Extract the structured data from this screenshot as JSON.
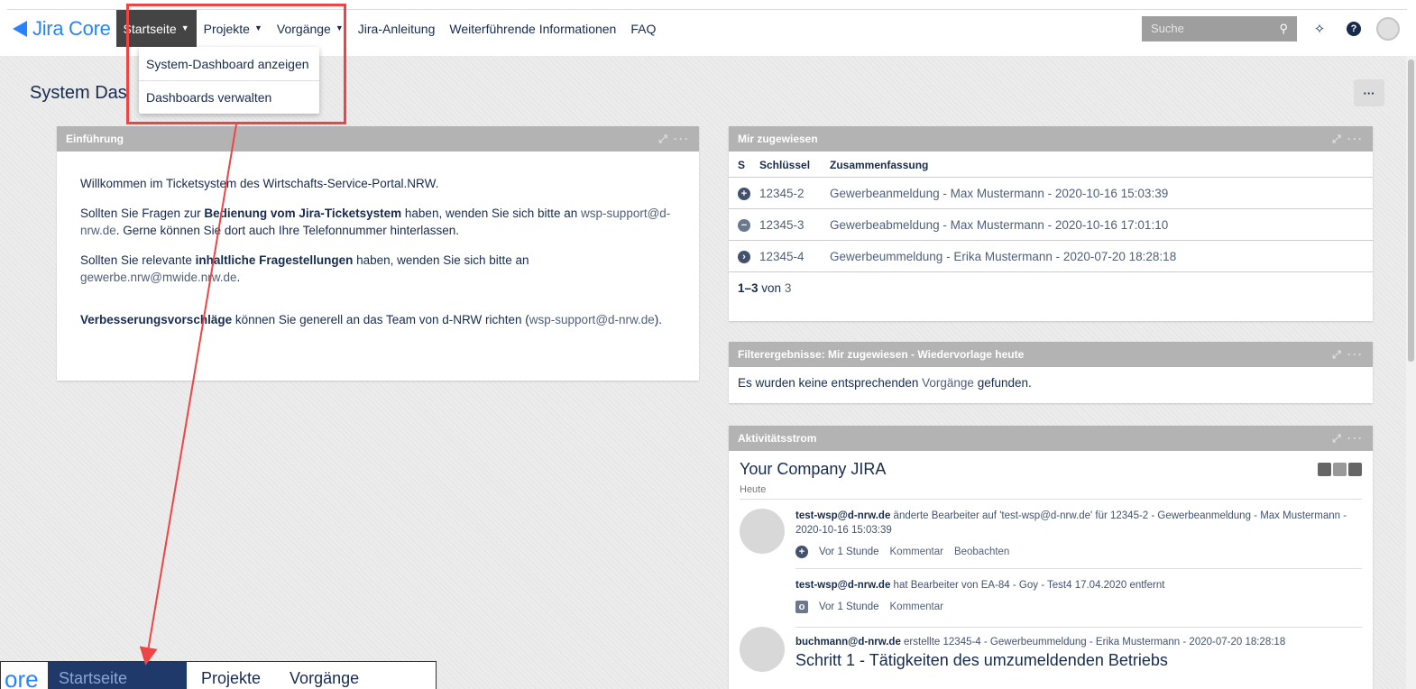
{
  "nav": {
    "logo": "Jira Core",
    "items": [
      {
        "label": "Startseite",
        "dropdown": true,
        "active": true
      },
      {
        "label": "Projekte",
        "dropdown": true
      },
      {
        "label": "Vorgänge",
        "dropdown": true
      },
      {
        "label": "Jira-Anleitung",
        "dropdown": false
      },
      {
        "label": "Weiterführende Informationen",
        "dropdown": false
      },
      {
        "label": "FAQ",
        "dropdown": false
      }
    ],
    "search_placeholder": "Suche"
  },
  "dropdown": {
    "items": [
      "System-Dashboard anzeigen",
      "Dashboards verwalten"
    ]
  },
  "page": {
    "title": "System Das",
    "more": "···"
  },
  "intro": {
    "header": "Einführung",
    "p1": "Willkommen im Ticketsystem des Wirtschafts-Service-Portal.NRW.",
    "p2_a": "Sollten Sie Fragen zur ",
    "p2_b": "Bedienung vom Jira-Ticketsystem",
    "p2_c": " haben, wenden Sie sich bitte an ",
    "p2_link": "wsp-support@d-nrw.de",
    "p2_d": ". Gerne können Sie dort auch Ihre Telefonnummer hinterlassen.",
    "p3_a": "Sollten Sie relevante ",
    "p3_b": "inhaltliche Fragestellungen",
    "p3_c": " haben, wenden Sie sich bitte an ",
    "p3_link": "gewerbe.nrw@mwide.nrw.de",
    "p3_d": ".",
    "p4_a": "Verbesserungsvorschläge",
    "p4_b": " können Sie generell an das Team von d-NRW richten (",
    "p4_link": "wsp-support@d-nrw.de",
    "p4_c": ")."
  },
  "assigned": {
    "header": "Mir zugewiesen",
    "columns": [
      "S",
      "Schlüssel",
      "Zusammenfassung"
    ],
    "rows": [
      {
        "status": "+",
        "key": "12345-2",
        "summary": "Gewerbeanmeldung - Max Mustermann - 2020-10-16 15:03:39"
      },
      {
        "status": "−",
        "key": "12345-3",
        "summary": "Gewerbeabmeldung - Max Mustermann - 2020-10-16 17:01:10"
      },
      {
        "status": "›",
        "key": "12345-4",
        "summary": "Gewerbeummeldung - Erika Mustermann - 2020-07-20 18:28:18"
      }
    ],
    "pager_range": "1–3",
    "pager_of": "von",
    "pager_total": "3"
  },
  "filter": {
    "header": "Filterergebnisse: Mir zugewiesen - Wiedervorlage heute",
    "text_a": "Es wurden keine entsprechenden ",
    "text_link": "Vorgänge",
    "text_b": " gefunden."
  },
  "activity": {
    "header": "Aktivitätsstrom",
    "title": "Your Company JIRA",
    "day": "Heute",
    "item1_user": "test-wsp@d-nrw.de",
    "item1_text": " änderte Bearbeiter auf 'test-wsp@d-nrw.de' für 12345-2 - Gewerbeanmeldung - Max Mustermann - 2020-10-16 15:03:39",
    "item1_time": "Vor 1 Stunde",
    "item1_comment": "Kommentar",
    "item1_watch": "Beobachten",
    "item2_user": "test-wsp@d-nrw.de",
    "item2_text": " hat Bearbeiter von EA-84 - Goy - Test4 17.04.2020 entfernt",
    "item2_time": "Vor 1 Stunde",
    "item2_comment": "Kommentar",
    "item3_user": "buchmann@d-nrw.de",
    "item3_text": " erstellte 12345-4 - Gewerbeummeldung - Erika Mustermann - 2020-07-20 18:28:18",
    "item3_big": "Schritt 1 - Tätigkeiten des umzumeldenden Betriebs"
  },
  "zoom": {
    "logo": "ore",
    "active": "Startseite",
    "item1": "Projekte",
    "item2": "Vorgänge"
  },
  "colors": {
    "accent": "#2684ff",
    "annotation": "#ef4444"
  }
}
